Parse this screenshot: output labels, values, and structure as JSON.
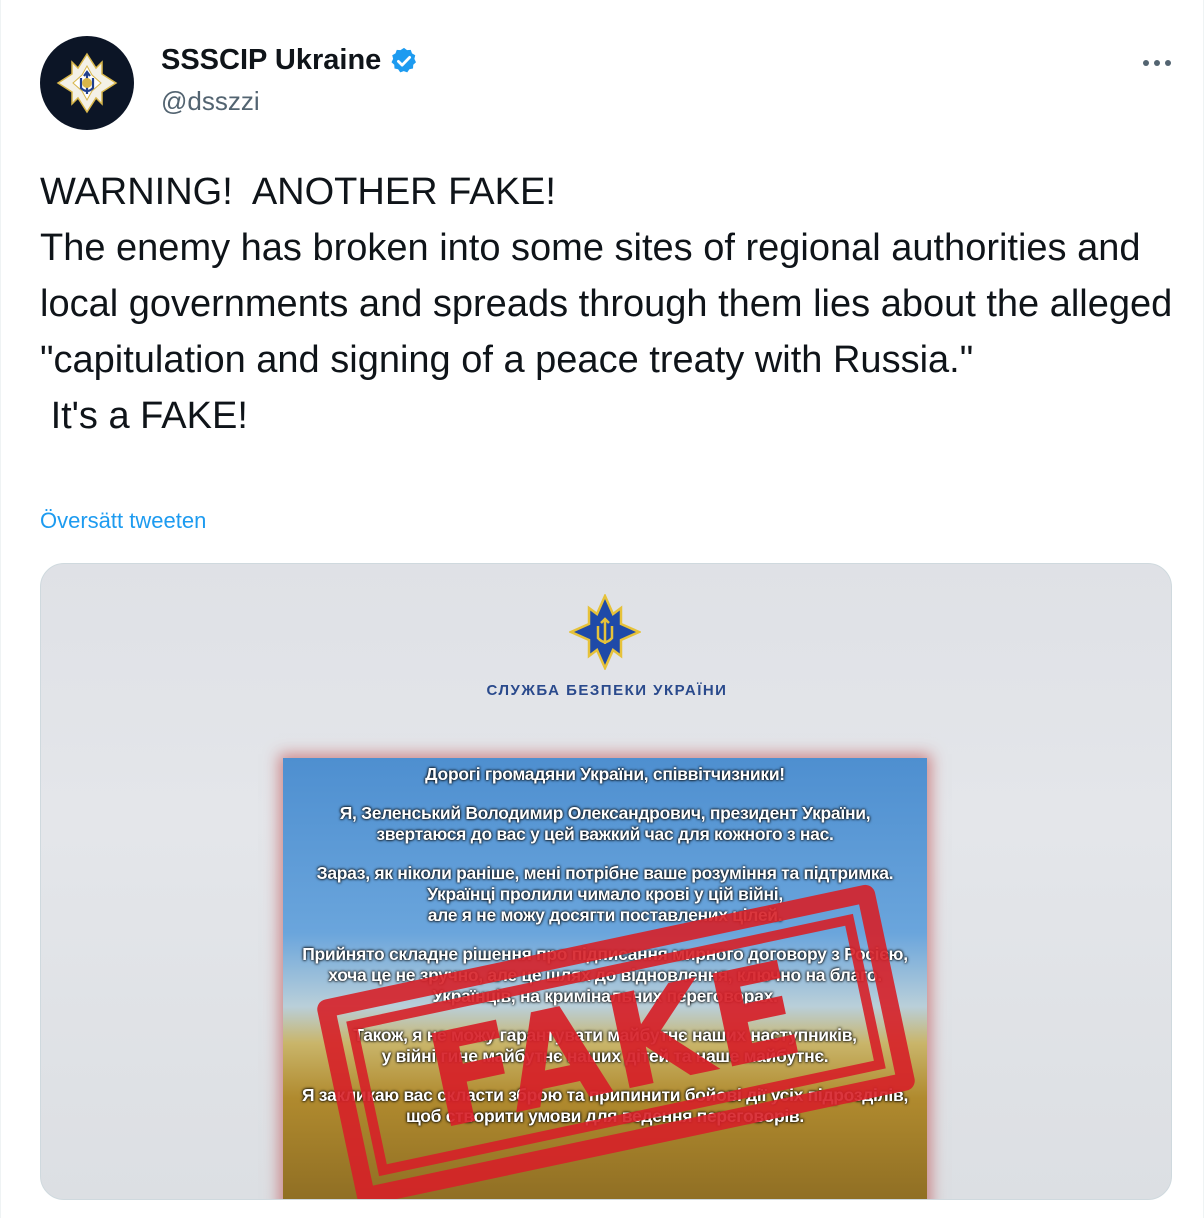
{
  "author": {
    "display_name": "SSSCIP Ukraine",
    "handle": "@dsszzi",
    "avatar_icon": "ssscip-emblem-icon",
    "verified_icon": "verified-badge-icon"
  },
  "more_icon": "more-options-icon",
  "tweet": {
    "text": "WARNING!  ANOTHER FAKE!\nThe enemy has broken into some sites of regional authorities and local governments and spreads through them lies about the alleged \"capitulation and signing of a peace treaty with Russia.\"\n It's a FAKE!",
    "translate_label": "Översätt tweeten"
  },
  "media": {
    "org_name": "СЛУЖБА БЕЗПЕКИ УКРАЇНИ",
    "notice_lines": [
      "Дорогі громадяни України, співвітчизники!",
      "",
      "Я, Зеленський Володимир Олександрович, президент України,",
      "звертаюся до вас у цей важкий час для кожного з нас.",
      "",
      "Зараз, як ніколи раніше, мені потрібне ваше розуміння та підтримка.",
      "Українці пролили чимало крові у цій війні,",
      "але я не можу досягти поставлених цілей.",
      "",
      "Прийнято складне рішення про підписання мирного договору з Росією,",
      "хоча це не зручно, але це шлях до відновлення, ключно на благо.",
      "Українців, на кримінальних переговорах.",
      "",
      "Також, я не можу гарантувати майбутнє наших наступників,",
      "у війні гине майбутнє наших дітей та наше майбутнє.",
      "",
      "Я закликаю вас скласти зброю та припинити бойові дії усіх підрозділів,",
      "щоб створити умови для ведення переговорів."
    ],
    "stamp_text": "FAKE",
    "colors": {
      "stamp_red": "#d62028",
      "sbu_blue": "#2a4a8c",
      "link_blue": "#1d9bf0"
    }
  }
}
